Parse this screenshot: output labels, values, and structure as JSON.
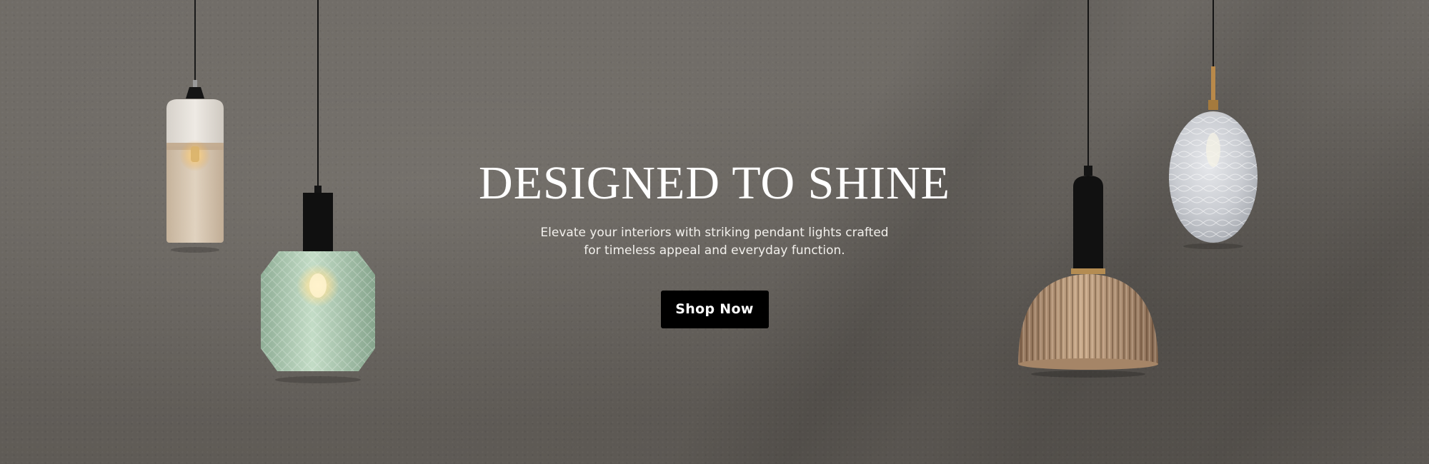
{
  "hero": {
    "headline": "DESIGNED TO SHINE",
    "subtitle_line1": "Elevate your interiors with striking pendant lights crafted",
    "subtitle_line2": "for timeless appeal and everyday function.",
    "cta_label": "Shop Now"
  },
  "pendants": [
    {
      "name": "beige-cylinder-pendant-lamp",
      "glass": "frosted beige"
    },
    {
      "name": "green-prism-pendant-lamp",
      "glass": "textured green"
    },
    {
      "name": "amber-ribbed-dome-pendant-lamp",
      "glass": "ribbed amber"
    },
    {
      "name": "clear-oval-pendant-lamp",
      "glass": "textured clear"
    }
  ],
  "colors": {
    "wall": "#6a6661",
    "cta_background": "#000000",
    "text": "#ffffff",
    "green_glass": "#a9c6ad",
    "amber_glass": "#b19276",
    "beige_glass": "#e6d9c8",
    "brass_accent": "#c09a5a"
  }
}
